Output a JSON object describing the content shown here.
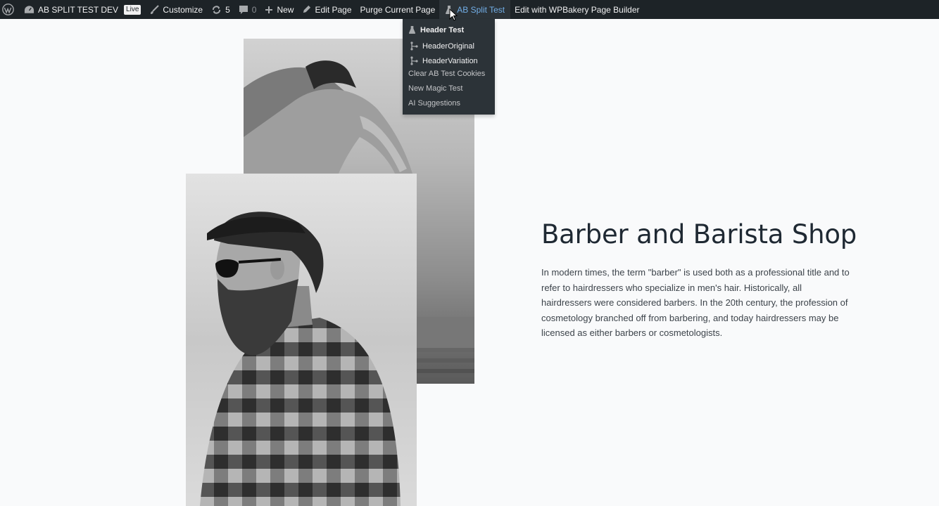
{
  "adminbar": {
    "site_name": "AB SPLIT TEST DEV",
    "live_badge": "Live",
    "customize": "Customize",
    "updates_count": "5",
    "comments_count": "0",
    "new": "New",
    "edit_page": "Edit Page",
    "purge": "Purge Current Page",
    "ab_split_test": "AB Split Test",
    "wpbakery": "Edit with WPBakery Page Builder"
  },
  "dropdown": {
    "items": [
      {
        "label": "Header Test",
        "icon": "flask-icon"
      },
      {
        "label": "HeaderOriginal",
        "icon": "branch-icon"
      },
      {
        "label": "HeaderVariation",
        "icon": "branch-icon"
      },
      {
        "label": "Clear AB Test Cookies",
        "icon": ""
      },
      {
        "label": "New Magic Test",
        "icon": ""
      },
      {
        "label": "AI Suggestions",
        "icon": ""
      }
    ]
  },
  "content": {
    "title": "Barber and Barista Shop",
    "paragraph": "In modern times, the term \"barber\" is used both as a professional title and to refer to hairdressers who specialize in men's hair. Historically, all hairdressers were considered barbers. In the 20th century, the profession of cosmetology branched off from barbering, and today hairdressers may be licensed as either barbers or cosmetologists."
  },
  "colors": {
    "adminbar_bg": "#1d2327",
    "dropdown_bg": "#2c3338",
    "accent": "#72aee6",
    "page_bg": "#f9fafb"
  }
}
